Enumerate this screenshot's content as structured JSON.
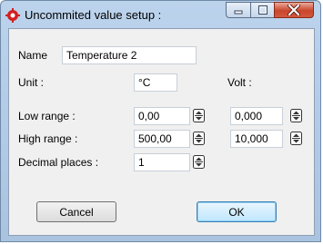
{
  "window": {
    "title": "Uncommited value setup :"
  },
  "name": {
    "label": "Name",
    "value": "Temperature 2"
  },
  "unit": {
    "label": "Unit :",
    "value": "°C",
    "volt_label": "Volt :"
  },
  "low_range": {
    "label": "Low range :",
    "value": "0,00",
    "volt_value": "0,000"
  },
  "high_range": {
    "label": "High range :",
    "value": "500,00",
    "volt_value": "10,000"
  },
  "decimal_places": {
    "label": "Decimal places :",
    "value": "1"
  },
  "buttons": {
    "cancel": "Cancel",
    "ok": "OK"
  },
  "icons": {
    "app": "crosshair-icon",
    "spin": "spin-arrows-icon"
  },
  "colors": {
    "app_icon": "#d42020",
    "title_bar": "#b7cde8",
    "close_button": "#c9462c"
  }
}
